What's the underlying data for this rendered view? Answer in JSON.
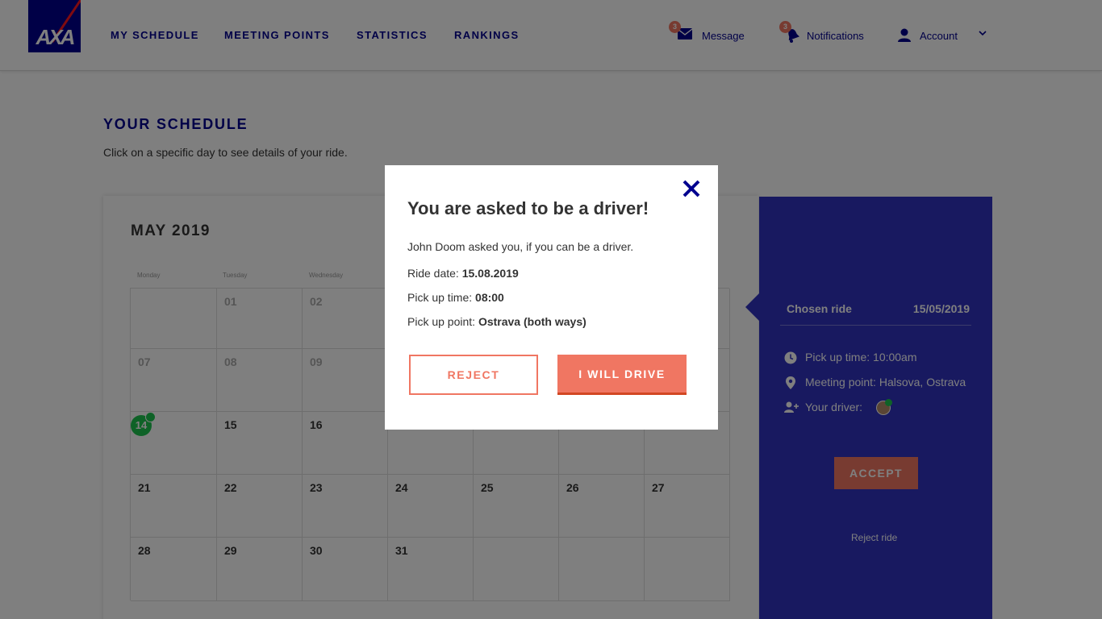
{
  "header": {
    "logo_text": "AXA",
    "nav": [
      "MY SCHEDULE",
      "MEETING POINTS",
      "STATISTICS",
      "RANKINGS"
    ],
    "message": {
      "label": "Message",
      "badge": "3"
    },
    "notifications": {
      "label": "Notifications",
      "badge": "3"
    },
    "account": {
      "label": "Account"
    }
  },
  "page": {
    "title": "YOUR SCHEDULE",
    "subtitle": "Click on a specific day to see details of your ride."
  },
  "calendar": {
    "month": "MAY 2019",
    "weekdays": [
      "Monday",
      "Tuesday",
      "Wednesday"
    ],
    "rows": [
      [
        "",
        "01",
        "02",
        "",
        "",
        "",
        ""
      ],
      [
        "07",
        "08",
        "09",
        "",
        "",
        "",
        ""
      ],
      [
        "14",
        "15",
        "16",
        "",
        "",
        "",
        ""
      ],
      [
        "21",
        "22",
        "23",
        "24",
        "25",
        "26",
        "27"
      ],
      [
        "28",
        "29",
        "30",
        "31",
        "",
        "",
        ""
      ]
    ]
  },
  "panel": {
    "chosen_label": "Chosen ride",
    "chosen_date": "15/05/2019",
    "pickup": "Pick up time: 10:00am",
    "meeting": "Meeting point: Halsova, Ostrava",
    "driver": "Your driver:",
    "accept": "ACCEPT",
    "reject_ride": "Reject ride"
  },
  "modal": {
    "title": "You are asked to be a driver!",
    "text": "John Doom asked you, if you can be a driver.",
    "ride_date_label": "Ride date:",
    "ride_date": "15.08.2019",
    "pickup_label": "Pick up time:",
    "pickup": "08:00",
    "point_label": "Pick up point:",
    "point": "Ostrava (both ways)",
    "reject": "REJECT",
    "drive": "I WILL DRIVE"
  },
  "colors": {
    "brand": "#00008f",
    "accent": "#f07662",
    "panel": "#3032c1",
    "success": "#1cc54e"
  }
}
